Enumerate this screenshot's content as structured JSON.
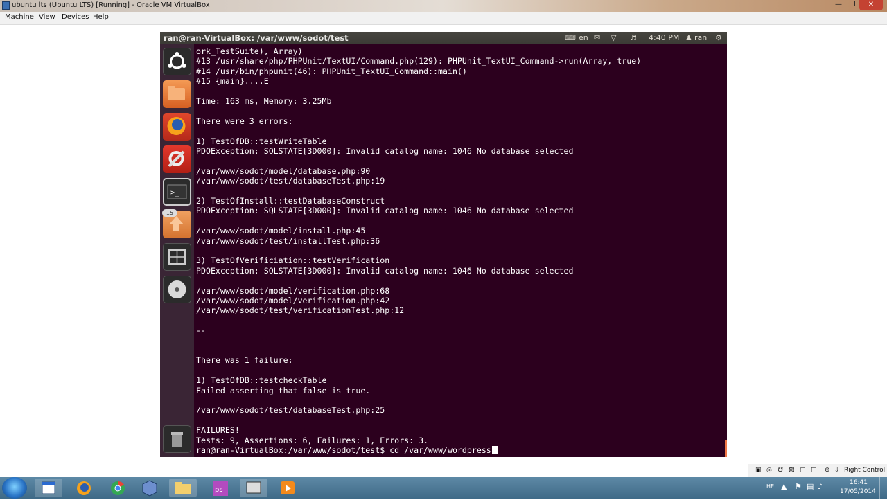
{
  "host_window": {
    "title": "ubuntu lts (Ubuntu LTS) [Running] - Oracle VM VirtualBox",
    "menu": [
      "Machine",
      "View",
      "Devices",
      "Help"
    ],
    "status_host_key": "Right Control"
  },
  "guest_topbar": {
    "window_title": "ran@ran-VirtualBox: /var/www/sodot/test",
    "keyboard_layout": "en",
    "clock": "4:40 PM",
    "user": "ran"
  },
  "launcher": {
    "badge_count": "15",
    "items": [
      "ubuntu-logo-icon",
      "files-icon",
      "firefox-icon",
      "system-settings-icon",
      "terminal-icon",
      "software-updater-icon",
      "workspaces-icon",
      "cd-drive-icon",
      "trash-icon"
    ]
  },
  "terminal": {
    "lines": [
      "ork_TestSuite), Array)",
      "#13 /usr/share/php/PHPUnit/TextUI/Command.php(129): PHPUnit_TextUI_Command->run(Array, true)",
      "#14 /usr/bin/phpunit(46): PHPUnit_TextUI_Command::main()",
      "#15 {main}....E",
      "",
      "Time: 163 ms, Memory: 3.25Mb",
      "",
      "There were 3 errors:",
      "",
      "1) TestOfDB::testWriteTable",
      "PDOException: SQLSTATE[3D000]: Invalid catalog name: 1046 No database selected",
      "",
      "/var/www/sodot/model/database.php:90",
      "/var/www/sodot/test/databaseTest.php:19",
      "",
      "2) TestOfInstall::testDatabaseConstruct",
      "PDOException: SQLSTATE[3D000]: Invalid catalog name: 1046 No database selected",
      "",
      "/var/www/sodot/model/install.php:45",
      "/var/www/sodot/test/installTest.php:36",
      "",
      "3) TestOfVerificiation::testVerification",
      "PDOException: SQLSTATE[3D000]: Invalid catalog name: 1046 No database selected",
      "",
      "/var/www/sodot/model/verification.php:68",
      "/var/www/sodot/model/verification.php:42",
      "/var/www/sodot/test/verificationTest.php:12",
      "",
      "--",
      "",
      "",
      "There was 1 failure:",
      "",
      "1) TestOfDB::testcheckTable",
      "Failed asserting that false is true.",
      "",
      "/var/www/sodot/test/databaseTest.php:25",
      "",
      "FAILURES!",
      "Tests: 9, Assertions: 6, Failures: 1, Errors: 3."
    ],
    "prompt": "ran@ran-VirtualBox:/var/www/sodot/test$ cd /var/www/wordpress"
  },
  "windows_taskbar": {
    "items": [
      "start-orb",
      "file-explorer-window-icon",
      "firefox-icon",
      "chrome-icon",
      "virtualbox-icon",
      "explorer-folder-icon",
      "phpstorm-icon",
      "virtualbox-vm-icon",
      "media-player-icon"
    ],
    "lang": "HE",
    "time": "16:41",
    "date": "17/05/2014"
  }
}
